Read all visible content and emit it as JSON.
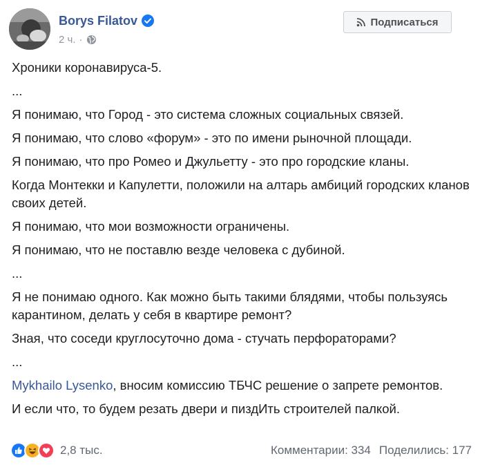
{
  "author": {
    "name": "Borys Filatov",
    "time": "2 ч.",
    "separator": "·"
  },
  "subscribe": {
    "label": "Подписаться"
  },
  "post": {
    "paragraphs": [
      "Хроники коронавируса-5.",
      "...",
      "Я понимаю, что Город - это система сложных социальных связей.",
      "Я понимаю, что слово «форум» - это по имени рыночной площади.",
      "Я понимаю, что про Ромео и Джульетту - это про городские кланы.",
      "Когда Монтекки и Капулетти, положили на алтарь амбиций городских кланов своих детей.",
      "Я понимаю, что мои возможности ограничены.",
      "Я понимаю, что не поставлю везде человека с дубиной.",
      "...",
      "Я не понимаю одного. Как можно быть такими блядями, чтобы пользуясь карантином, делать у себя в квартире ремонт?",
      "Зная, что соседи круглосуточно дома - стучать перфораторами?",
      "..."
    ],
    "mention": {
      "name": "Mykhailo Lysenko",
      "text": ", вносим комиссию ТБЧС решение о запрете ремонтов."
    },
    "closing": "И если что, то будем резать двери и пиздИть строителей палкой."
  },
  "footer": {
    "reaction_icons": [
      "like-icon",
      "haha-icon",
      "love-icon"
    ],
    "reaction_count": "2,8 тыс.",
    "comments": "Комментарии: 334",
    "shares": "Поделились: 177"
  },
  "colors": {
    "link": "#385898",
    "text": "#1c1e21",
    "muted": "#90949c",
    "like": "#1877f2",
    "love": "#f33e58",
    "haha": "#f7b125"
  }
}
